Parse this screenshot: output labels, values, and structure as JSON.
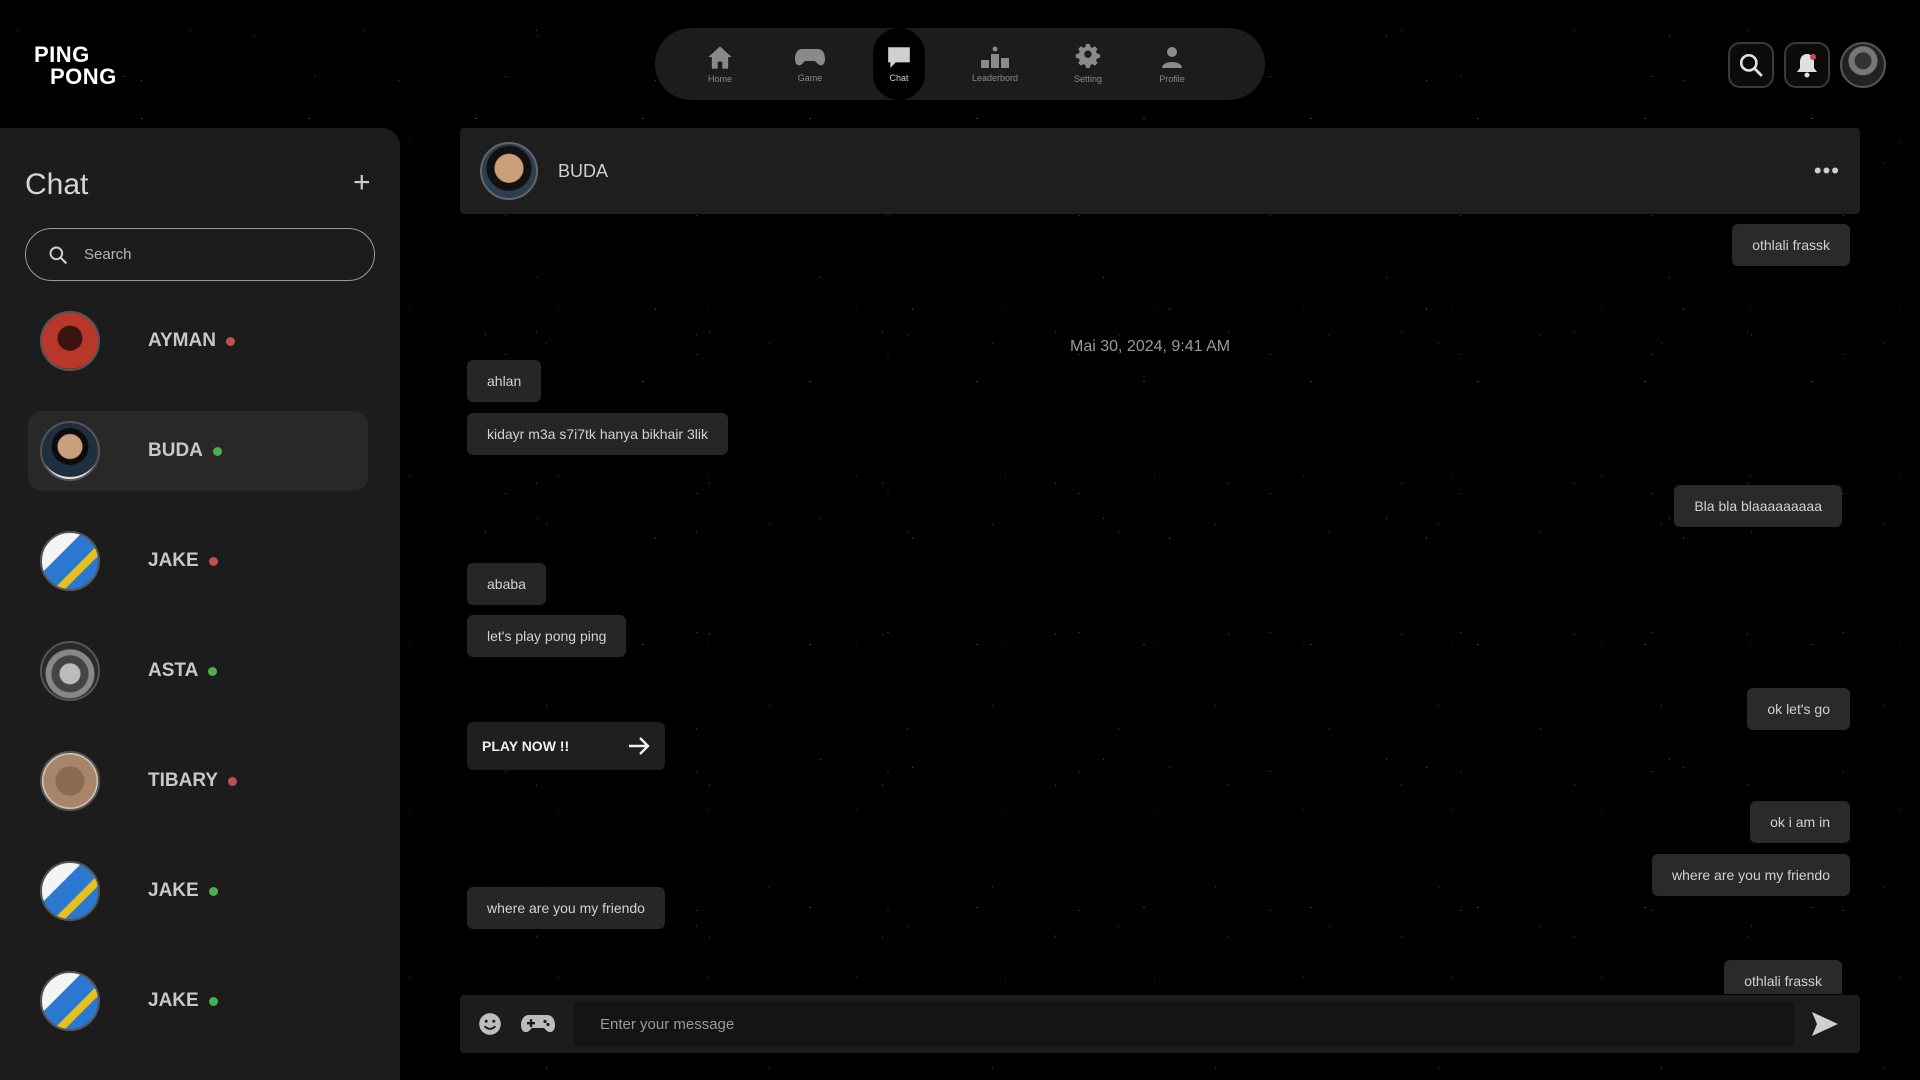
{
  "app": {
    "logo_line1": "PING",
    "logo_line2": "PONG"
  },
  "nav": {
    "items": [
      {
        "label": "Home",
        "icon": "home-icon",
        "active": false
      },
      {
        "label": "Game",
        "icon": "gamepad-icon",
        "active": false
      },
      {
        "label": "Chat",
        "icon": "chat-bubble-icon",
        "active": true
      },
      {
        "label": "Leaderbord",
        "icon": "podium-icon",
        "active": false
      },
      {
        "label": "Setting",
        "icon": "gear-icon",
        "active": false
      },
      {
        "label": "Profile",
        "icon": "user-icon",
        "active": false
      }
    ]
  },
  "top_icons": [
    "search-icon",
    "bell-icon",
    "avatar"
  ],
  "sidebar": {
    "title": "Chat",
    "add_label": "+",
    "search_placeholder": "Search",
    "contacts": [
      {
        "name": "AYMAN",
        "status": "offline",
        "selected": false
      },
      {
        "name": "BUDA",
        "status": "online",
        "selected": true
      },
      {
        "name": "JAKE",
        "status": "offline",
        "selected": false
      },
      {
        "name": "ASTA",
        "status": "online",
        "selected": false
      },
      {
        "name": "TIBARY",
        "status": "offline",
        "selected": false
      },
      {
        "name": "JAKE",
        "status": "online",
        "selected": false
      },
      {
        "name": "JAKE",
        "status": "online",
        "selected": false
      }
    ]
  },
  "colors": {
    "online": "#4caf50",
    "offline": "#c0504d",
    "background": "#000000",
    "panel": "#1c1c1c"
  },
  "chat": {
    "contact_name": "BUDA",
    "more_label": "•••",
    "timestamp": "Mai 30, 2024, 9:41 AM",
    "messages": [
      {
        "text": "othlali frassk",
        "side": "right"
      },
      {
        "text": "ahlan",
        "side": "left"
      },
      {
        "text": "kidayr m3a s7i7tk hanya bikhair 3lik",
        "side": "left"
      },
      {
        "text": "Bla bla blaaaaaaaaa",
        "side": "right"
      },
      {
        "text": "ababa",
        "side": "left"
      },
      {
        "text": "let's play pong ping",
        "side": "left"
      },
      {
        "text": "ok let's go",
        "side": "right"
      },
      {
        "text": "ok i am in",
        "side": "right"
      },
      {
        "text": "where are you my friendo",
        "side": "right"
      },
      {
        "text": "where are you my friendo",
        "side": "left"
      },
      {
        "text": "othlali frassk",
        "side": "right"
      }
    ],
    "play_card_label": "PLAY NOW !!",
    "composer_placeholder": "Enter your message"
  }
}
